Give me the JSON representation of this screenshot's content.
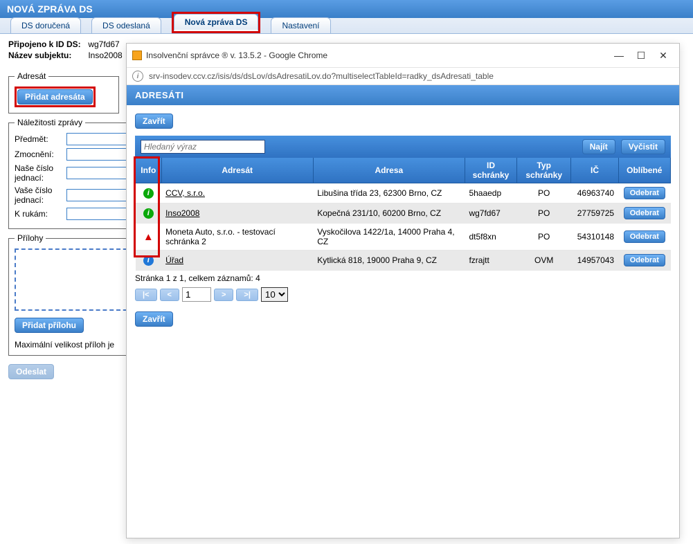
{
  "main": {
    "title": "NOVÁ ZPRÁVA DS",
    "tabs": [
      {
        "label": "DS doručená"
      },
      {
        "label": "DS odeslaná"
      },
      {
        "label": "Nová zpráva DS"
      },
      {
        "label": "Nastavení"
      }
    ],
    "conn": {
      "id_label": "Připojeno k ID DS:",
      "id_value": "wg7fd67",
      "name_label": "Název subjektu:",
      "name_value": "Inso2008"
    },
    "adresat": {
      "legend": "Adresát",
      "add_btn": "Přidat adresáta"
    },
    "nalezitosti": {
      "legend": "Náležitosti zprávy",
      "predmet": "Předmět:",
      "zmocneni": "Zmocnění:",
      "nase_cj": "Naše číslo jednací:",
      "vase_cj": "Vaše číslo jednací:",
      "krukam": "K rukám:"
    },
    "prilohy": {
      "legend": "Přílohy",
      "add_btn": "Přidat přílohu",
      "max_text": "Maximální velikost příloh je"
    },
    "send_btn": "Odeslat"
  },
  "popup": {
    "title": "Insolvenční správce ® v. 13.5.2 - Google Chrome",
    "url": "srv-insodev.ccv.cz/isis/ds/dsLov/dsAdresatiLov.do?multiselectTableId=radky_dsAdresati_table",
    "heading": "ADRESÁTI",
    "close_btn": "Zavřít",
    "search": {
      "placeholder": "Hledaný výraz",
      "find": "Najít",
      "clear": "Vyčistit"
    },
    "columns": {
      "info": "Info",
      "adresat": "Adresát",
      "adresa": "Adresa",
      "idschranky": "ID schránky",
      "typ": "Typ schránky",
      "ic": "IČ",
      "oblibene": "Oblíbené"
    },
    "rows": [
      {
        "icon": "green",
        "name": "CCV, s.r.o.",
        "addr": "Libušina třída 23, 62300 Brno, CZ",
        "id": "5haaedp",
        "typ": "PO",
        "ic": "46963740",
        "action": "Odebrat",
        "link": true
      },
      {
        "icon": "green",
        "name": "Inso2008",
        "addr": "Kopečná 231/10, 60200 Brno, CZ",
        "id": "wg7fd67",
        "typ": "PO",
        "ic": "27759725",
        "action": "Odebrat",
        "link": true
      },
      {
        "icon": "warn",
        "name": "Moneta Auto, s.r.o. - testovací schránka 2",
        "addr": "Vyskočilova 1422/1a, 14000 Praha 4, CZ",
        "id": "dt5f8xn",
        "typ": "PO",
        "ic": "54310148",
        "action": "Odebrat",
        "link": false
      },
      {
        "icon": "blue",
        "name": "Úřad",
        "addr": "Kytlická 818, 19000 Praha 9, CZ",
        "id": "fzrajtt",
        "typ": "OVM",
        "ic": "14957043",
        "action": "Odebrat",
        "link": true
      }
    ],
    "pager": {
      "summary": "Stránka 1 z 1, celkem záznamů: 4",
      "first": "|<",
      "prev": "<",
      "page": "1",
      "next": ">",
      "last": ">|",
      "size": "10"
    }
  }
}
